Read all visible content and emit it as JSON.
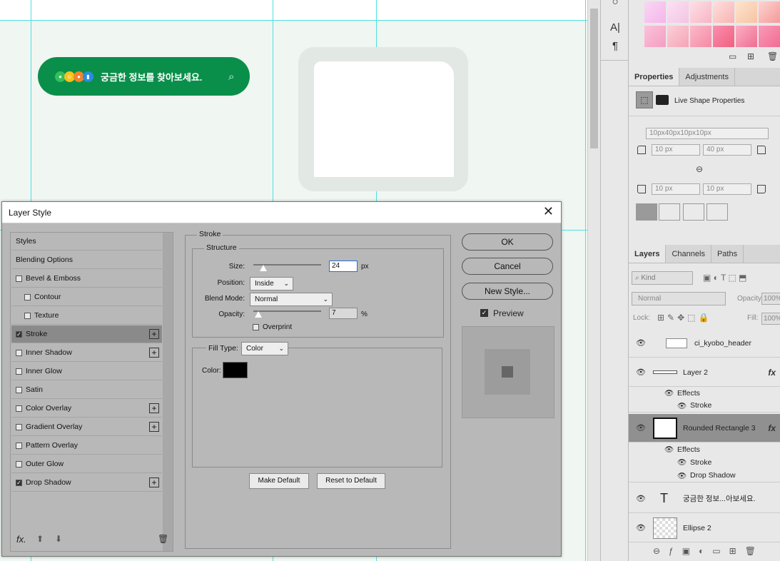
{
  "canvas": {
    "search_pill_text": "궁금한 정보를 찾아보세요.",
    "search_icon": "search-icon"
  },
  "toolstrip": {
    "t1": "A|",
    "t2": "¶"
  },
  "properties": {
    "tabs": [
      "Properties",
      "Adjustments"
    ],
    "live_shape": "Live Shape Properties",
    "radius_summary": "10px40px10px10px",
    "r_tl": "10 px",
    "r_tr": "40 px",
    "r_bl": "10 px",
    "r_br": "10 px"
  },
  "layers": {
    "tabs": [
      "Layers",
      "Channels",
      "Paths"
    ],
    "kind": "Kind",
    "blend": "Normal",
    "opacity_label": "Opacity:",
    "opacity": "100%",
    "lock_label": "Lock:",
    "fill_label": "Fill:",
    "fill": "100%",
    "items": [
      {
        "name": "ci_kyobo_header",
        "fx": ""
      },
      {
        "name": "Layer 2",
        "fx": "fx"
      },
      {
        "name": "Rounded Rectangle 3",
        "fx": "fx"
      },
      {
        "name": "궁금한 정보...아보세요.",
        "fx": ""
      },
      {
        "name": "Ellipse 2",
        "fx": ""
      }
    ],
    "effects_label": "Effects",
    "stroke_label": "Stroke",
    "drop_shadow_label": "Drop Shadow"
  },
  "dialog": {
    "title": "Layer Style",
    "styles": [
      {
        "label": "Styles",
        "check": null,
        "plus": false,
        "sel": false,
        "indent": false
      },
      {
        "label": "Blending Options",
        "check": null,
        "plus": false,
        "sel": false,
        "indent": false
      },
      {
        "label": "Bevel & Emboss",
        "check": false,
        "plus": false,
        "sel": false,
        "indent": false
      },
      {
        "label": "Contour",
        "check": false,
        "plus": false,
        "sel": false,
        "indent": true
      },
      {
        "label": "Texture",
        "check": false,
        "plus": false,
        "sel": false,
        "indent": true
      },
      {
        "label": "Stroke",
        "check": true,
        "plus": true,
        "sel": true,
        "indent": false
      },
      {
        "label": "Inner Shadow",
        "check": false,
        "plus": true,
        "sel": false,
        "indent": false
      },
      {
        "label": "Inner Glow",
        "check": false,
        "plus": false,
        "sel": false,
        "indent": false
      },
      {
        "label": "Satin",
        "check": false,
        "plus": false,
        "sel": false,
        "indent": false
      },
      {
        "label": "Color Overlay",
        "check": false,
        "plus": true,
        "sel": false,
        "indent": false
      },
      {
        "label": "Gradient Overlay",
        "check": false,
        "plus": true,
        "sel": false,
        "indent": false
      },
      {
        "label": "Pattern Overlay",
        "check": false,
        "plus": false,
        "sel": false,
        "indent": false
      },
      {
        "label": "Outer Glow",
        "check": false,
        "plus": false,
        "sel": false,
        "indent": false
      },
      {
        "label": "Drop Shadow",
        "check": true,
        "plus": true,
        "sel": false,
        "indent": false
      }
    ],
    "stroke_title": "Stroke",
    "structure_title": "Structure",
    "size_label": "Size:",
    "size_value": "24",
    "size_unit": "px",
    "size_fraction": 0.15,
    "position_label": "Position:",
    "position_value": "Inside",
    "blend_label": "Blend Mode:",
    "blend_value": "Normal",
    "opacity_label": "Opacity:",
    "opacity_value": "7",
    "opacity_unit": "%",
    "opacity_fraction": 0.07,
    "overprint_label": "Overprint",
    "fill_type_label": "Fill Type:",
    "fill_type_value": "Color",
    "color_label": "Color:",
    "color_value": "#000000",
    "make_default": "Make Default",
    "reset_default": "Reset to Default",
    "ok": "OK",
    "cancel": "Cancel",
    "new_style": "New Style...",
    "preview_label": "Preview",
    "fx_label": "fx."
  }
}
